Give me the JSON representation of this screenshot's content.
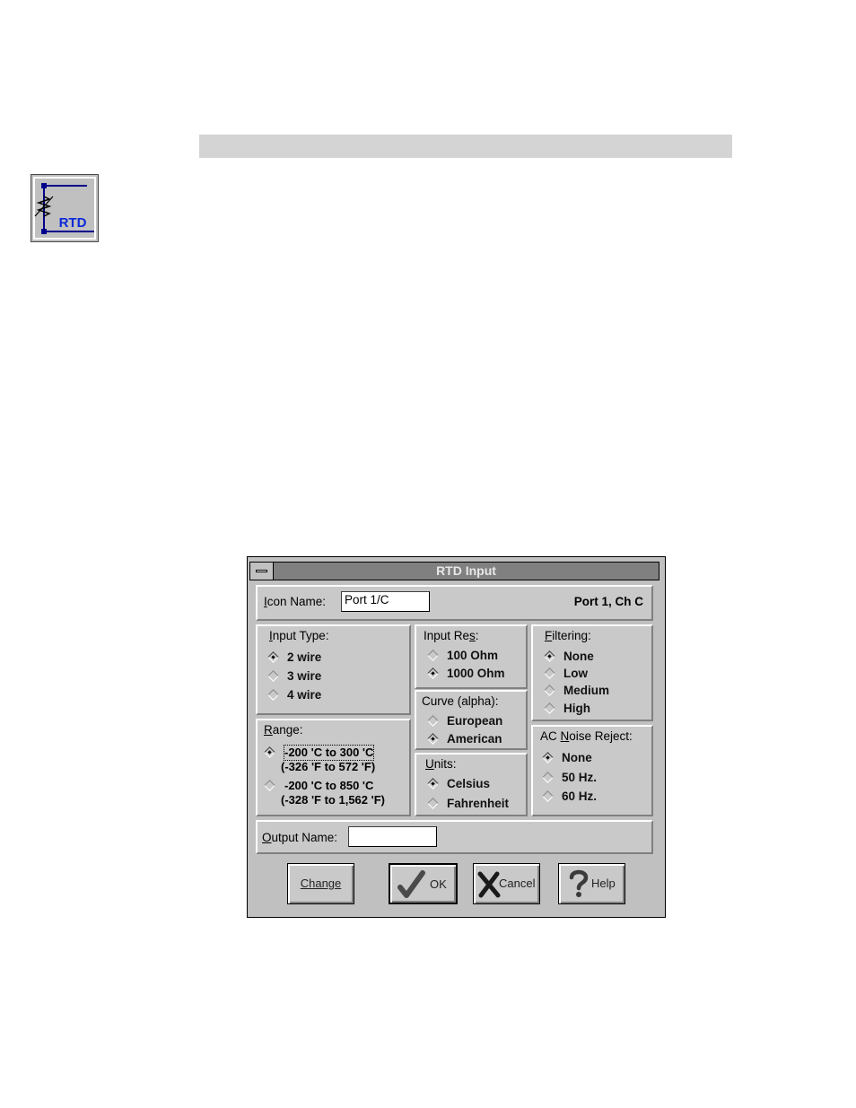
{
  "page": {
    "icon": {
      "name": "rtd-icon",
      "label": "RTD"
    }
  },
  "dialog": {
    "title": "RTD Input",
    "icon_name": {
      "label": "Icon Name:",
      "value": "Port 1/C"
    },
    "port_info": "Port 1, Ch C",
    "input_type": {
      "label": "Input Type:",
      "options": [
        "2 wire",
        "3 wire",
        "4 wire"
      ],
      "selected": "2 wire"
    },
    "input_res": {
      "label": "Input Res:",
      "options": [
        "100 Ohm",
        "1000 Ohm"
      ],
      "selected": "1000 Ohm"
    },
    "filtering": {
      "label": "Filtering:",
      "options": [
        "None",
        "Low",
        "Medium",
        "High"
      ],
      "selected": "None"
    },
    "curve": {
      "label": "Curve (alpha):",
      "options": [
        "European",
        "American"
      ],
      "selected": "American"
    },
    "range": {
      "label": "Range:",
      "options": [
        {
          "line1": "-200 'C  to  300 'C",
          "line2": "(-326 'F  to  572 'F)"
        },
        {
          "line1": "-200 'C  to  850 'C",
          "line2": "(-328 'F to 1,562 'F)"
        }
      ],
      "selected_index": 0
    },
    "units": {
      "label": "Units:",
      "options": [
        "Celsius",
        "Fahrenheit"
      ],
      "selected": "Celsius"
    },
    "ac_noise_reject": {
      "label": "AC Noise Reject:",
      "options": [
        "None",
        "50 Hz.",
        "60 Hz."
      ],
      "selected": "None"
    },
    "output_name": {
      "label": "Output Name:",
      "value": ""
    },
    "buttons": {
      "change": "Change",
      "ok": "OK",
      "cancel": "Cancel",
      "help": "Help"
    }
  }
}
